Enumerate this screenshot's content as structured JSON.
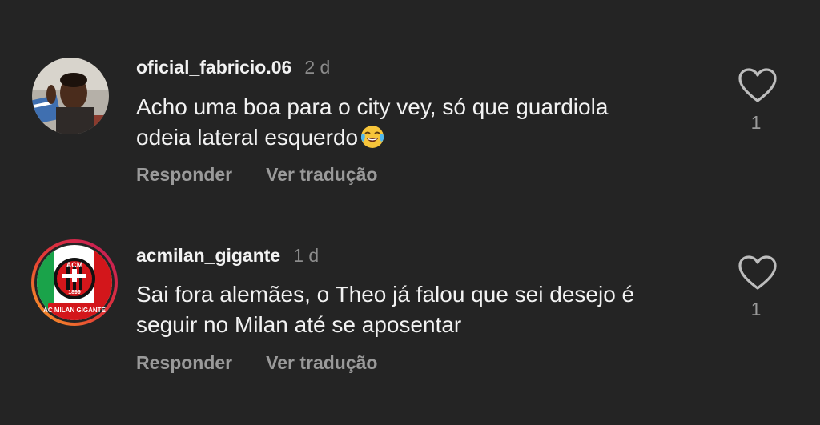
{
  "comments": [
    {
      "username": "oficial_fabricio.06",
      "time": "2 d",
      "line1": "Acho uma boa para o city vey, só que guardiola",
      "line2": "odeia lateral esquerdo",
      "emoji": "face-with-tears-of-joy-icon",
      "likes": "1",
      "reply_label": "Responder",
      "translate_label": "Ver tradução"
    },
    {
      "username": "acmilan_gigante",
      "time": "1 d",
      "line1": "Sai fora alemães, o Theo já falou que sei desejo é",
      "line2": "seguir no Milan até se aposentar",
      "likes": "1",
      "reply_label": "Responder",
      "translate_label": "Ver tradução",
      "avatar_logo_text": "AC MILAN GIGANTE",
      "avatar_badge_text": "ACM",
      "avatar_year": "1899"
    }
  ],
  "colors": {
    "background": "#242424",
    "text_primary": "#f2f2f2",
    "text_secondary": "#9a9a9a",
    "milan_red": "#d3161b"
  }
}
